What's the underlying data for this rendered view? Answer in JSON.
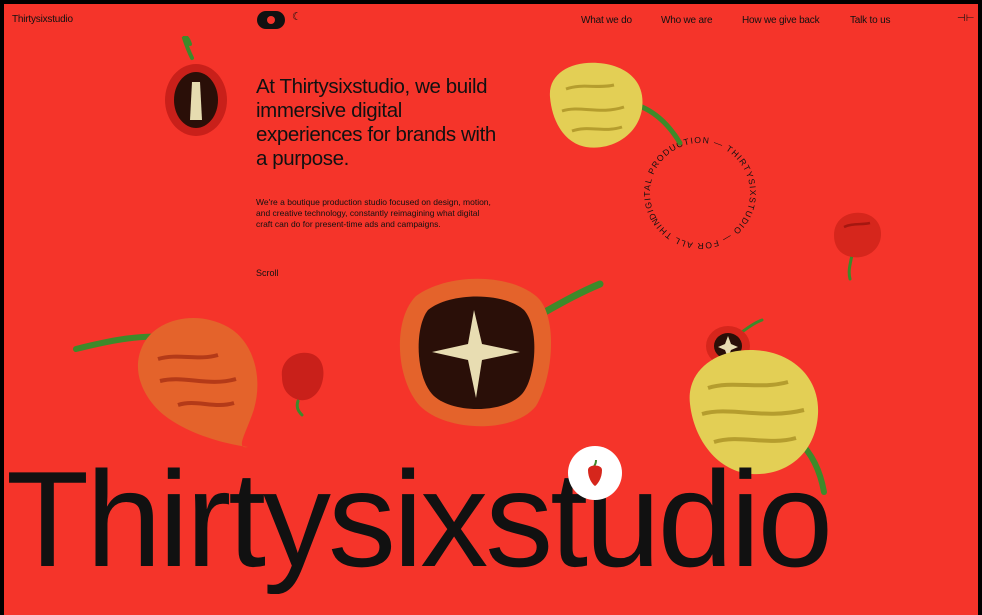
{
  "nav": {
    "brand": "Thirtysixstudio",
    "links": [
      "What we do",
      "Who we are",
      "How we give back",
      "Talk to us"
    ],
    "moon_icon": "☾",
    "sound_icon": "⊣⊢"
  },
  "hero": {
    "headline": "At Thirtysixstudio, we build immersive digital experiences for brands with a purpose.",
    "body": "We're a boutique production studio focused on design, motion, and creative technology, constantly reimagining what digital craft can do for present-time ads and campaigns.",
    "scroll_label": "Scroll"
  },
  "ring_text": "DIGITAL PRODUCTION — THIRTYSIXSTUDIO — FOR ALL THINGS ",
  "big_word": "Thirtysixstudio",
  "colors": {
    "background": "#f5342a",
    "text": "#111111"
  }
}
